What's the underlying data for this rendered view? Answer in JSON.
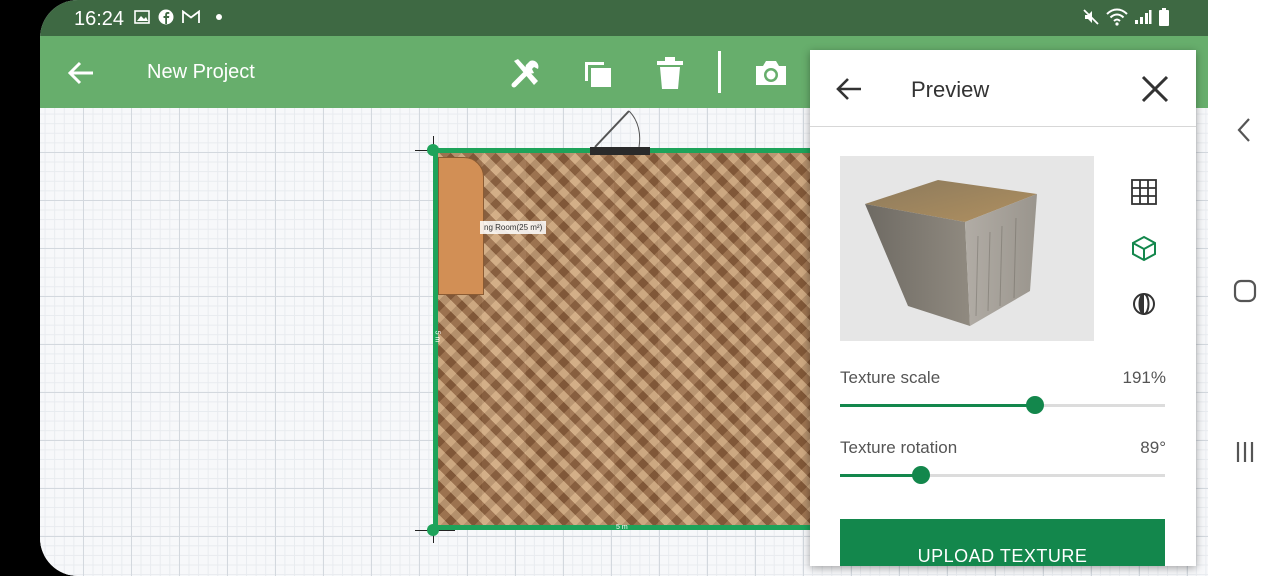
{
  "status_bar": {
    "time": "16:24"
  },
  "app_bar": {
    "title": "New Project"
  },
  "room": {
    "label": "ng Room(25 m²)",
    "dim_bottom": "5 m",
    "dim_left": "5 m"
  },
  "panel": {
    "title": "Preview",
    "texture_scale": {
      "label": "Texture scale",
      "value_text": "191%",
      "slider_fraction": 0.6
    },
    "texture_rotation": {
      "label": "Texture rotation",
      "value_text": "89°",
      "slider_fraction": 0.25
    },
    "upload_label": "UPLOAD TEXTURE"
  },
  "colors": {
    "status_bar": "#3e6943",
    "app_bar": "#67ae6c",
    "accent": "#13874c",
    "wall": "#1ea35a"
  },
  "icons": [
    "back-arrow-icon",
    "tools-icon",
    "copy-icon",
    "trash-icon",
    "camera-icon",
    "close-icon",
    "grid-view-icon",
    "cube-view-icon",
    "sphere-view-icon",
    "nav-back-icon",
    "nav-home-icon",
    "nav-recents-icon"
  ]
}
